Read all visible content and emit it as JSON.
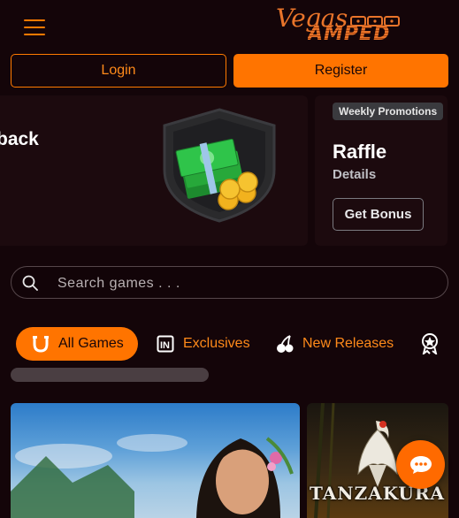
{
  "header": {
    "logo_line1": "Vegas",
    "logo_line2": "AMPED"
  },
  "auth": {
    "login_label": "Login",
    "register_label": "Register"
  },
  "promo": {
    "left_partial_text": "back",
    "badge": "Weekly Promotions",
    "title": "Raffle",
    "details": "Details",
    "cta": "Get Bonus"
  },
  "search": {
    "placeholder": "Search games . . ."
  },
  "categories": [
    {
      "label": "All Games",
      "icon": "horseshoe-icon",
      "active": true
    },
    {
      "label": "Exclusives",
      "icon": "in-badge-icon",
      "active": false
    },
    {
      "label": "New Releases",
      "icon": "cherries-icon",
      "active": false
    },
    {
      "label": "",
      "icon": "award-star-icon",
      "active": false
    }
  ],
  "games": [
    {
      "name": ""
    },
    {
      "name": "TANZAKURA"
    }
  ],
  "colors": {
    "accent": "#ff7400",
    "background": "#140509",
    "card": "#1c0a0e"
  }
}
